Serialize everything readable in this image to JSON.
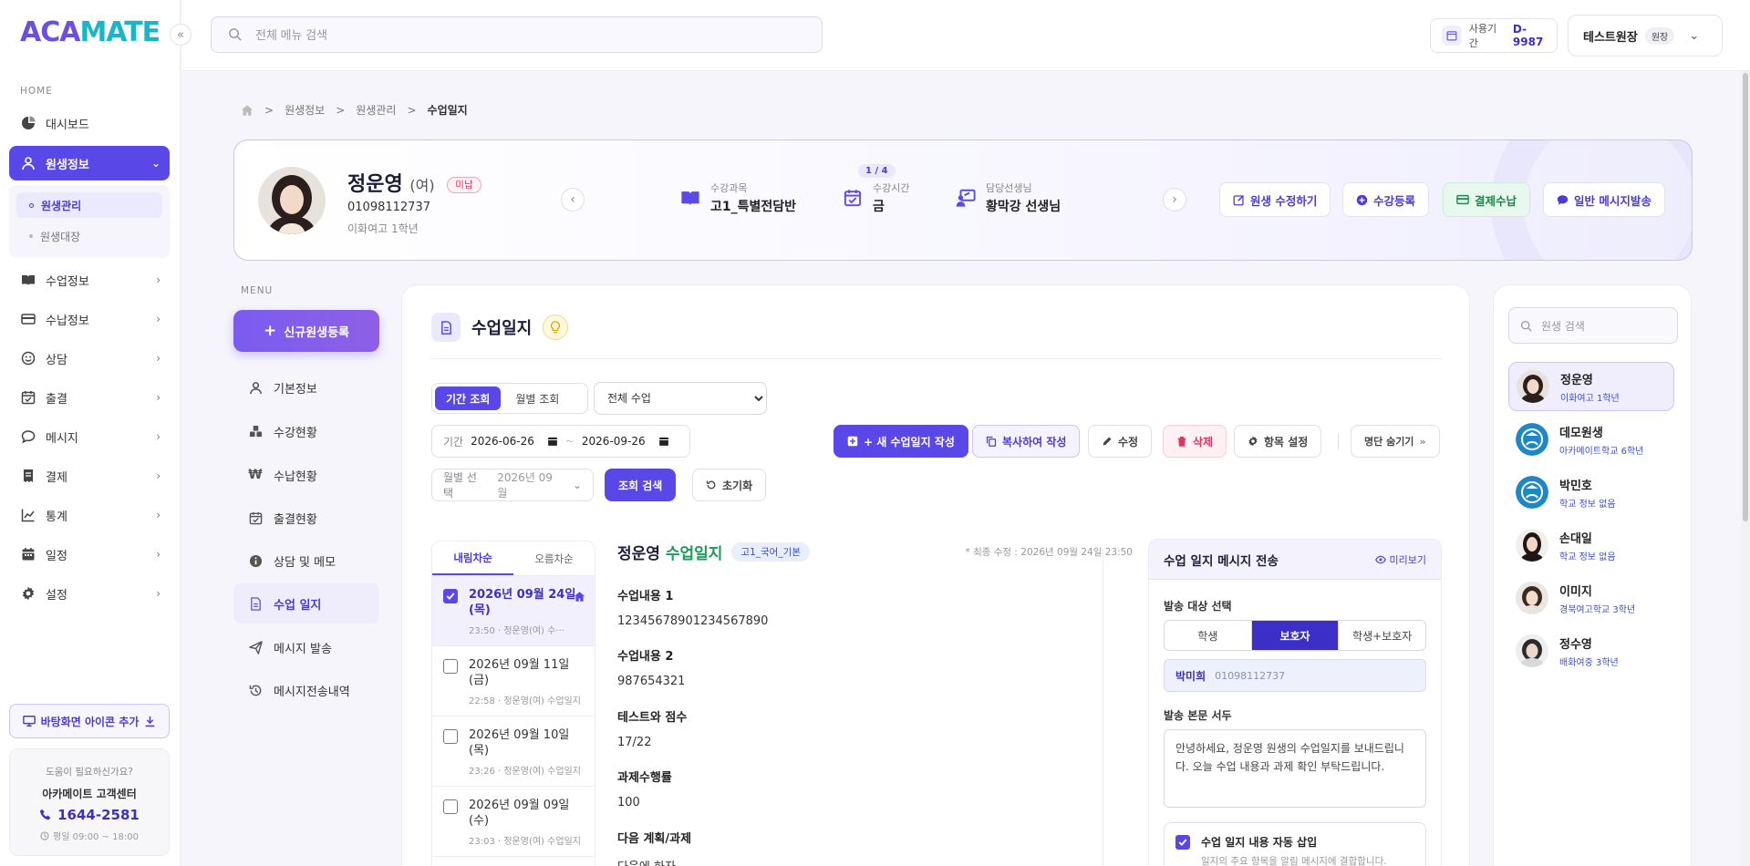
{
  "app": {
    "logo_a": "ACA",
    "logo_b": "MATE"
  },
  "sidebar": {
    "home_label": "HOME",
    "items": [
      {
        "label": "대시보드"
      },
      {
        "label": "원생정보"
      },
      {
        "label": "수업정보"
      },
      {
        "label": "수납정보"
      },
      {
        "label": "상담"
      },
      {
        "label": "출결"
      },
      {
        "label": "메시지"
      },
      {
        "label": "결제"
      },
      {
        "label": "통계"
      },
      {
        "label": "일정"
      },
      {
        "label": "설정"
      }
    ],
    "sub_items": [
      {
        "label": "원생관리"
      },
      {
        "label": "원생대장"
      }
    ],
    "shortcut_label": "바탕화면 아이콘 추가",
    "help": {
      "question": "도움이 필요하신가요?",
      "center": "아카메이트 고객센터",
      "phone": "1644-2581",
      "hours": "평일 09:00 ~ 18:00"
    }
  },
  "topbar": {
    "search_placeholder": "전체 메뉴 검색",
    "period_label": "사용기간",
    "period_value": "D-9987",
    "user_name": "테스트원장",
    "user_role": "원장"
  },
  "breadcrumb": {
    "items": [
      "원생정보",
      "원생관리"
    ],
    "current": "수업일지"
  },
  "student": {
    "name": "정운영",
    "gender": "(여)",
    "status_tag": "미납",
    "phone": "01098112737",
    "school": "이화여고 1학년",
    "course_label": "수강과목",
    "course_value": "고1_특별전담반",
    "time_count": "1 / 4",
    "time_label": "수강시간",
    "time_value": "금",
    "teacher_label": "담당선생님",
    "teacher_value": "황막강 선생님",
    "buttons": {
      "edit": "원생 수정하기",
      "enroll": "수강등록",
      "pay": "결제수납",
      "message": "일반 메시지발송"
    }
  },
  "menu": {
    "label": "MENU",
    "new_button": "신규원생등록",
    "items": [
      {
        "label": "기본정보"
      },
      {
        "label": "수강현황"
      },
      {
        "label": "수납현황"
      },
      {
        "label": "출결현황"
      },
      {
        "label": "상담 및 메모"
      },
      {
        "label": "수업 일지"
      },
      {
        "label": "메시지 발송"
      },
      {
        "label": "메시지전송내역"
      }
    ]
  },
  "main": {
    "title": "수업일지",
    "seg_period": "기간 조회",
    "seg_month": "월별 조회",
    "class_select": "전체 수업",
    "date_label": "기간",
    "date_from": "2026-06-26",
    "date_sep": "~",
    "date_to": "2026-09-26",
    "month_label": "월별 선택",
    "month_value": "2026년 09월",
    "search_button": "조회 검색",
    "reset_button": "초기화",
    "new_log": "+ 새 수업일지 작성",
    "copy_log": "복사하여 작성",
    "edit": "수정",
    "delete": "삭제",
    "item_settings": "항목 설정",
    "hide_roster": "명단 숨기기"
  },
  "list": {
    "tab_desc": "내림차순",
    "tab_asc": "오름차순",
    "entries": [
      {
        "date": "2026년 09월 24일 (목)",
        "sub": "23:50 · 정운영(여) 수···"
      },
      {
        "date": "2026년 09월 11일 (금)",
        "sub": "22:58 · 정운영(여) 수업일지"
      },
      {
        "date": "2026년 09월 10일 (목)",
        "sub": "23:26 · 정운영(여) 수업일지"
      },
      {
        "date": "2026년 09월 09일 (수)",
        "sub": "23:03 · 정운영(여) 수업일지"
      }
    ]
  },
  "detail": {
    "name": "정운영",
    "title_suffix": "수업일지",
    "class_tag": "고1_국어_기본",
    "updated": "* 최종 수정 : 2026년 09월 24일 23:50",
    "fields": [
      {
        "label": "수업내용 1",
        "value": "12345678901234567890"
      },
      {
        "label": "수업내용 2",
        "value": "987654321"
      },
      {
        "label": "테스트와 점수",
        "value": "17/22"
      },
      {
        "label": "과제수행률",
        "value": "100"
      },
      {
        "label": "다음 계획/과제",
        "value": "다음에 하자"
      }
    ]
  },
  "message_panel": {
    "title": "수업 일지 메시지 전송",
    "preview": "미리보기",
    "target_label": "발송 대상 선택",
    "targets": [
      "학생",
      "보호자",
      "학생+보호자"
    ],
    "recipient_name": "박미희",
    "recipient_phone": "01098112737",
    "intro_label": "발송 본문 서두",
    "intro_text": "안녕하세요, 정운영 원생의 수업일지를 보내드립니다. 오늘 수업 내용과 과제 확인 부탁드립니다.",
    "auto_title": "수업 일지 내용 자동 삽입",
    "auto_desc": "일지의 주요 항목을 알림 메시지에 결합합니다."
  },
  "roster": {
    "search_placeholder": "원생 검색",
    "students": [
      {
        "name": "정운영",
        "school": "이화여고 1학년"
      },
      {
        "name": "데모원생",
        "school": "아카메이트학교 6학년"
      },
      {
        "name": "박민호",
        "school": "학교 정보 없음"
      },
      {
        "name": "손대일",
        "school": "학교 정보 없음"
      },
      {
        "name": "이미지",
        "school": "경북여고학교 3학년"
      },
      {
        "name": "정수영",
        "school": "배화여중 3학년"
      }
    ]
  },
  "colors": {
    "primary": "#5a47e8",
    "accent": "#19b5c9",
    "danger": "#e0345c",
    "success": "#1a8a4a"
  }
}
